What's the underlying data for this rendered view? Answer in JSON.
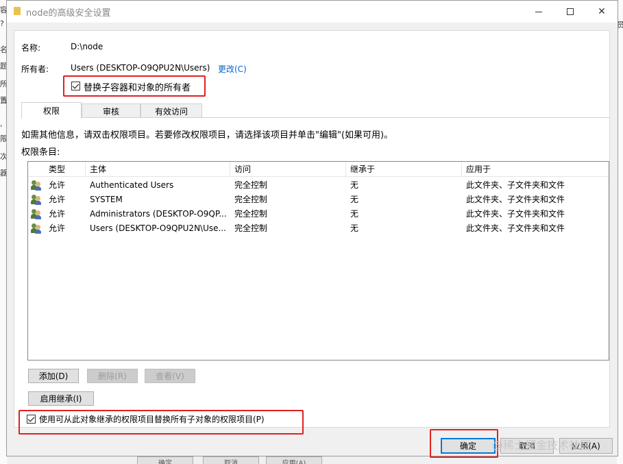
{
  "window": {
    "title": "node的高级安全设置"
  },
  "background_left_chars": [
    "容",
    "?",
    "名",
    "题",
    "所",
    "置",
    ",",
    "限",
    "次",
    "器"
  ],
  "background_right_char": "员",
  "fields": {
    "name_label": "名称:",
    "name_value": "D:\\node",
    "owner_label": "所有者:",
    "owner_value": "Users (DESKTOP-O9QPU2N\\Users)",
    "change_link": "更改(C)",
    "replace_owner_label": "替换子容器和对象的所有者"
  },
  "tabs": [
    {
      "label": "权限"
    },
    {
      "label": "审核"
    },
    {
      "label": "有效访问"
    }
  ],
  "info_text": "如需其他信息，请双击权限项目。若要修改权限项目，请选择该项目并单击\"编辑\"(如果可用)。",
  "entries_label": "权限条目:",
  "table": {
    "headers": [
      "类型",
      "主体",
      "访问",
      "继承于",
      "应用于"
    ],
    "rows": [
      {
        "type": "允许",
        "principal": "Authenticated Users",
        "access": "完全控制",
        "inherited": "无",
        "applies": "此文件夹、子文件夹和文件"
      },
      {
        "type": "允许",
        "principal": "SYSTEM",
        "access": "完全控制",
        "inherited": "无",
        "applies": "此文件夹、子文件夹和文件"
      },
      {
        "type": "允许",
        "principal": "Administrators (DESKTOP-O9QP...",
        "access": "完全控制",
        "inherited": "无",
        "applies": "此文件夹、子文件夹和文件"
      },
      {
        "type": "允许",
        "principal": "Users (DESKTOP-O9QPU2N\\Use...",
        "access": "完全控制",
        "inherited": "无",
        "applies": "此文件夹、子文件夹和文件"
      }
    ]
  },
  "buttons": {
    "add": "添加(D)",
    "remove": "删除(R)",
    "view": "查看(V)",
    "enable_inheritance": "启用继承(I)",
    "ok": "确定",
    "cancel": "取消",
    "apply": "应用(A)"
  },
  "replace_child_label": "使用可从此对象继承的权限项目替换所有子对象的权限项目(P)",
  "watermark": "@稀土掘金技术社区",
  "behind_buttons": [
    "确定",
    "取消",
    "应用(A)"
  ]
}
